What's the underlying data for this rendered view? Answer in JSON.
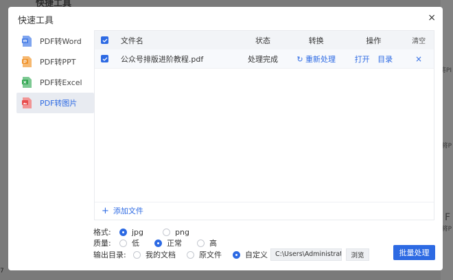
{
  "background": {
    "title": "快捷工具",
    "fragments": [
      "将PI",
      "将P",
      "将P"
    ],
    "big_fragment": "F",
    "corner_digit": "7"
  },
  "dialog": {
    "title": "快速工具",
    "close": "×"
  },
  "sidebar": {
    "items": [
      {
        "label": "PDF转Word",
        "icon": "pdf-to-word-icon",
        "color": "#4a7fe6"
      },
      {
        "label": "PDF转PPT",
        "icon": "pdf-to-ppt-icon",
        "color": "#f0932b"
      },
      {
        "label": "PDF转Excel",
        "icon": "pdf-to-excel-icon",
        "color": "#34a853"
      },
      {
        "label": "PDF转图片",
        "icon": "pdf-to-image-icon",
        "color": "#e84d4d",
        "active": true
      }
    ]
  },
  "table": {
    "headers": {
      "name": "文件名",
      "status": "状态",
      "convert": "转换",
      "operation": "操作",
      "clear": "清空"
    },
    "rows": [
      {
        "name": "公众号排版进阶教程.pdf",
        "status": "处理完成",
        "reprocess": "重新处理",
        "open": "打开",
        "directory": "目录",
        "remove": "×"
      }
    ],
    "add_file": "添加文件"
  },
  "options": {
    "format": {
      "label": "格式:",
      "choices": [
        "jpg",
        "png"
      ],
      "selected": "jpg"
    },
    "quality": {
      "label": "质量:",
      "choices": [
        "低",
        "正常",
        "高"
      ],
      "selected": "正常"
    },
    "output": {
      "label": "输出目录:",
      "choices": [
        "我的文档",
        "原文件",
        "自定义"
      ],
      "selected": "自定义",
      "path": "C:\\Users\\Administrator\\",
      "browse": "浏览"
    }
  },
  "batch_button": "批量处理",
  "colors": {
    "accent": "#2d6ae3"
  }
}
